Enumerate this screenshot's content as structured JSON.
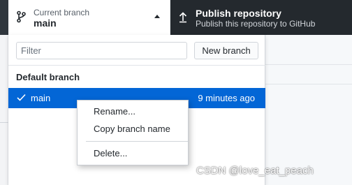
{
  "toolbar": {
    "current_branch": {
      "caption": "Current branch",
      "name": "main",
      "branch_icon": "git-branch-icon",
      "caret_icon": "caret-up-icon"
    },
    "publish": {
      "title": "Publish repository",
      "subtitle": "Publish this repository to GitHub",
      "icon": "upload-icon"
    }
  },
  "dropdown": {
    "filter": {
      "placeholder": "Filter",
      "value": ""
    },
    "new_branch_label": "New branch",
    "section_heading": "Default branch",
    "branches": [
      {
        "name": "main",
        "time": "9 minutes ago",
        "selected": true,
        "icon": "check-icon"
      }
    ]
  },
  "context_menu": {
    "items": [
      {
        "label": "Rename..."
      },
      {
        "label": "Copy branch name"
      },
      {
        "label": "Delete..."
      }
    ]
  },
  "watermark": "CSDN @love_eat_peach",
  "colors": {
    "toolbar_bg": "#24292e",
    "selection_blue": "#0366d6",
    "border": "#d1d5da"
  }
}
